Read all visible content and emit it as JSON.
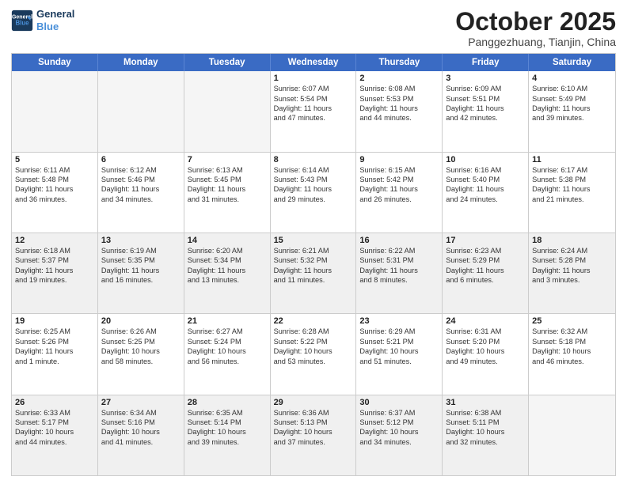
{
  "header": {
    "logo_line1": "General",
    "logo_line2": "Blue",
    "month": "October 2025",
    "location": "Panggezhuang, Tianjin, China"
  },
  "weekdays": [
    "Sunday",
    "Monday",
    "Tuesday",
    "Wednesday",
    "Thursday",
    "Friday",
    "Saturday"
  ],
  "rows": [
    [
      {
        "day": "",
        "lines": [],
        "empty": true
      },
      {
        "day": "",
        "lines": [],
        "empty": true
      },
      {
        "day": "",
        "lines": [],
        "empty": true
      },
      {
        "day": "1",
        "lines": [
          "Sunrise: 6:07 AM",
          "Sunset: 5:54 PM",
          "Daylight: 11 hours",
          "and 47 minutes."
        ]
      },
      {
        "day": "2",
        "lines": [
          "Sunrise: 6:08 AM",
          "Sunset: 5:53 PM",
          "Daylight: 11 hours",
          "and 44 minutes."
        ]
      },
      {
        "day": "3",
        "lines": [
          "Sunrise: 6:09 AM",
          "Sunset: 5:51 PM",
          "Daylight: 11 hours",
          "and 42 minutes."
        ]
      },
      {
        "day": "4",
        "lines": [
          "Sunrise: 6:10 AM",
          "Sunset: 5:49 PM",
          "Daylight: 11 hours",
          "and 39 minutes."
        ]
      }
    ],
    [
      {
        "day": "5",
        "lines": [
          "Sunrise: 6:11 AM",
          "Sunset: 5:48 PM",
          "Daylight: 11 hours",
          "and 36 minutes."
        ]
      },
      {
        "day": "6",
        "lines": [
          "Sunrise: 6:12 AM",
          "Sunset: 5:46 PM",
          "Daylight: 11 hours",
          "and 34 minutes."
        ]
      },
      {
        "day": "7",
        "lines": [
          "Sunrise: 6:13 AM",
          "Sunset: 5:45 PM",
          "Daylight: 11 hours",
          "and 31 minutes."
        ]
      },
      {
        "day": "8",
        "lines": [
          "Sunrise: 6:14 AM",
          "Sunset: 5:43 PM",
          "Daylight: 11 hours",
          "and 29 minutes."
        ]
      },
      {
        "day": "9",
        "lines": [
          "Sunrise: 6:15 AM",
          "Sunset: 5:42 PM",
          "Daylight: 11 hours",
          "and 26 minutes."
        ]
      },
      {
        "day": "10",
        "lines": [
          "Sunrise: 6:16 AM",
          "Sunset: 5:40 PM",
          "Daylight: 11 hours",
          "and 24 minutes."
        ]
      },
      {
        "day": "11",
        "lines": [
          "Sunrise: 6:17 AM",
          "Sunset: 5:38 PM",
          "Daylight: 11 hours",
          "and 21 minutes."
        ]
      }
    ],
    [
      {
        "day": "12",
        "lines": [
          "Sunrise: 6:18 AM",
          "Sunset: 5:37 PM",
          "Daylight: 11 hours",
          "and 19 minutes."
        ],
        "shaded": true
      },
      {
        "day": "13",
        "lines": [
          "Sunrise: 6:19 AM",
          "Sunset: 5:35 PM",
          "Daylight: 11 hours",
          "and 16 minutes."
        ],
        "shaded": true
      },
      {
        "day": "14",
        "lines": [
          "Sunrise: 6:20 AM",
          "Sunset: 5:34 PM",
          "Daylight: 11 hours",
          "and 13 minutes."
        ],
        "shaded": true
      },
      {
        "day": "15",
        "lines": [
          "Sunrise: 6:21 AM",
          "Sunset: 5:32 PM",
          "Daylight: 11 hours",
          "and 11 minutes."
        ],
        "shaded": true
      },
      {
        "day": "16",
        "lines": [
          "Sunrise: 6:22 AM",
          "Sunset: 5:31 PM",
          "Daylight: 11 hours",
          "and 8 minutes."
        ],
        "shaded": true
      },
      {
        "day": "17",
        "lines": [
          "Sunrise: 6:23 AM",
          "Sunset: 5:29 PM",
          "Daylight: 11 hours",
          "and 6 minutes."
        ],
        "shaded": true
      },
      {
        "day": "18",
        "lines": [
          "Sunrise: 6:24 AM",
          "Sunset: 5:28 PM",
          "Daylight: 11 hours",
          "and 3 minutes."
        ],
        "shaded": true
      }
    ],
    [
      {
        "day": "19",
        "lines": [
          "Sunrise: 6:25 AM",
          "Sunset: 5:26 PM",
          "Daylight: 11 hours",
          "and 1 minute."
        ]
      },
      {
        "day": "20",
        "lines": [
          "Sunrise: 6:26 AM",
          "Sunset: 5:25 PM",
          "Daylight: 10 hours",
          "and 58 minutes."
        ]
      },
      {
        "day": "21",
        "lines": [
          "Sunrise: 6:27 AM",
          "Sunset: 5:24 PM",
          "Daylight: 10 hours",
          "and 56 minutes."
        ]
      },
      {
        "day": "22",
        "lines": [
          "Sunrise: 6:28 AM",
          "Sunset: 5:22 PM",
          "Daylight: 10 hours",
          "and 53 minutes."
        ]
      },
      {
        "day": "23",
        "lines": [
          "Sunrise: 6:29 AM",
          "Sunset: 5:21 PM",
          "Daylight: 10 hours",
          "and 51 minutes."
        ]
      },
      {
        "day": "24",
        "lines": [
          "Sunrise: 6:31 AM",
          "Sunset: 5:20 PM",
          "Daylight: 10 hours",
          "and 49 minutes."
        ]
      },
      {
        "day": "25",
        "lines": [
          "Sunrise: 6:32 AM",
          "Sunset: 5:18 PM",
          "Daylight: 10 hours",
          "and 46 minutes."
        ]
      }
    ],
    [
      {
        "day": "26",
        "lines": [
          "Sunrise: 6:33 AM",
          "Sunset: 5:17 PM",
          "Daylight: 10 hours",
          "and 44 minutes."
        ],
        "shaded": true
      },
      {
        "day": "27",
        "lines": [
          "Sunrise: 6:34 AM",
          "Sunset: 5:16 PM",
          "Daylight: 10 hours",
          "and 41 minutes."
        ],
        "shaded": true
      },
      {
        "day": "28",
        "lines": [
          "Sunrise: 6:35 AM",
          "Sunset: 5:14 PM",
          "Daylight: 10 hours",
          "and 39 minutes."
        ],
        "shaded": true
      },
      {
        "day": "29",
        "lines": [
          "Sunrise: 6:36 AM",
          "Sunset: 5:13 PM",
          "Daylight: 10 hours",
          "and 37 minutes."
        ],
        "shaded": true
      },
      {
        "day": "30",
        "lines": [
          "Sunrise: 6:37 AM",
          "Sunset: 5:12 PM",
          "Daylight: 10 hours",
          "and 34 minutes."
        ],
        "shaded": true
      },
      {
        "day": "31",
        "lines": [
          "Sunrise: 6:38 AM",
          "Sunset: 5:11 PM",
          "Daylight: 10 hours",
          "and 32 minutes."
        ],
        "shaded": true
      },
      {
        "day": "",
        "lines": [],
        "empty": true,
        "shaded": false
      }
    ]
  ]
}
